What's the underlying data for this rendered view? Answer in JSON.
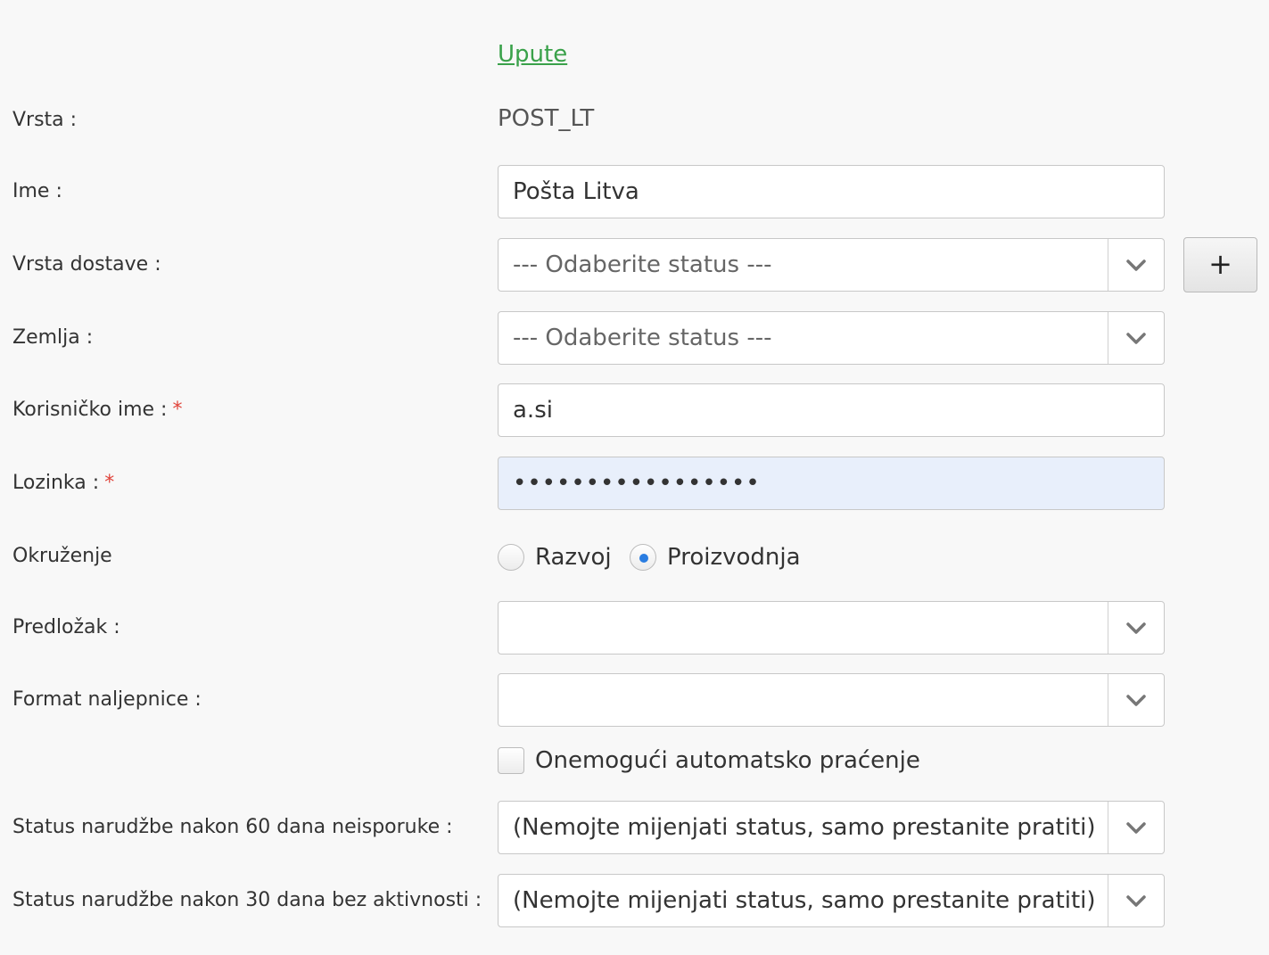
{
  "instructions_link": "Upute",
  "fields": {
    "type": {
      "label": "Vrsta :",
      "value": "POST_LT"
    },
    "name": {
      "label": "Ime :",
      "value": "Pošta Litva"
    },
    "delivery_type": {
      "label": "Vrsta dostave :",
      "value": "--- Odaberite status ---",
      "add_button": "+"
    },
    "country": {
      "label": "Zemlja :",
      "value": "--- Odaberite status ---"
    },
    "username": {
      "label": "Korisničko ime :",
      "required_mark": "*",
      "value": "a.si"
    },
    "password": {
      "label": "Lozinka :",
      "required_mark": "*",
      "value": "•••••••••••••••••"
    },
    "environment": {
      "label": "Okruženje",
      "options": [
        {
          "label": "Razvoj",
          "selected": false
        },
        {
          "label": "Proizvodnja",
          "selected": true
        }
      ]
    },
    "template": {
      "label": "Predložak :",
      "value": ""
    },
    "label_format": {
      "label": "Format naljepnice :",
      "value": ""
    },
    "disable_tracking": {
      "label": "Onemogući automatsko praćenje",
      "checked": false
    },
    "status_after_60": {
      "label": "Status narudžbe nakon 60 dana neisporuke :",
      "value": "(Nemojte mijenjati status, samo prestanite pratiti)"
    },
    "status_after_30": {
      "label": "Status narudžbe nakon 30 dana bez aktivnosti :",
      "value": "(Nemojte mijenjati status, samo prestanite pratiti)"
    }
  },
  "colors": {
    "background": "#f8f8f8",
    "link": "#3aa14a",
    "required": "#e0433a",
    "radio_selected": "#2a7de1",
    "autofill_bg": "#e8effb"
  },
  "icons": {
    "select_arrow": "chevron-down-icon",
    "add": "plus-icon"
  }
}
